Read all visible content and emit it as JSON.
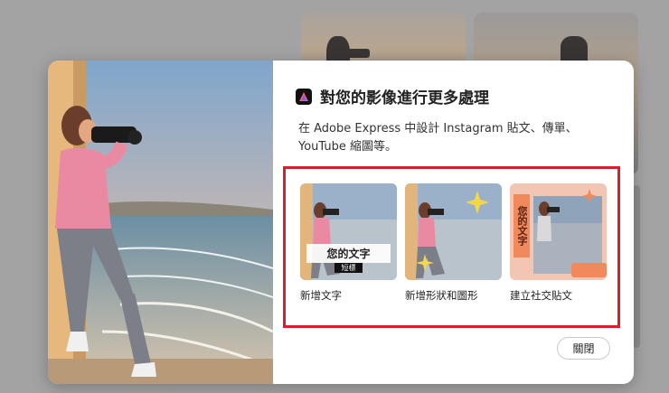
{
  "dialog": {
    "title": "對您的影像進行更多處理",
    "description": "在 Adobe Express 中設計 Instagram 貼文、傳單、YouTube 縮圖等。",
    "logo_icon": "adobe-express-logo-icon",
    "highlight_color": "#d8202d",
    "options": [
      {
        "label": "新增文字",
        "thumb_text_main": "您的文字",
        "thumb_text_sub": "短標"
      },
      {
        "label": "新增形狀和圖形",
        "icon": "sparkle-icon"
      },
      {
        "label": "建立社交貼文",
        "thumb_text_vertical": "您的文字",
        "accent": "#f08a5d"
      }
    ],
    "close_label": "關閉"
  }
}
